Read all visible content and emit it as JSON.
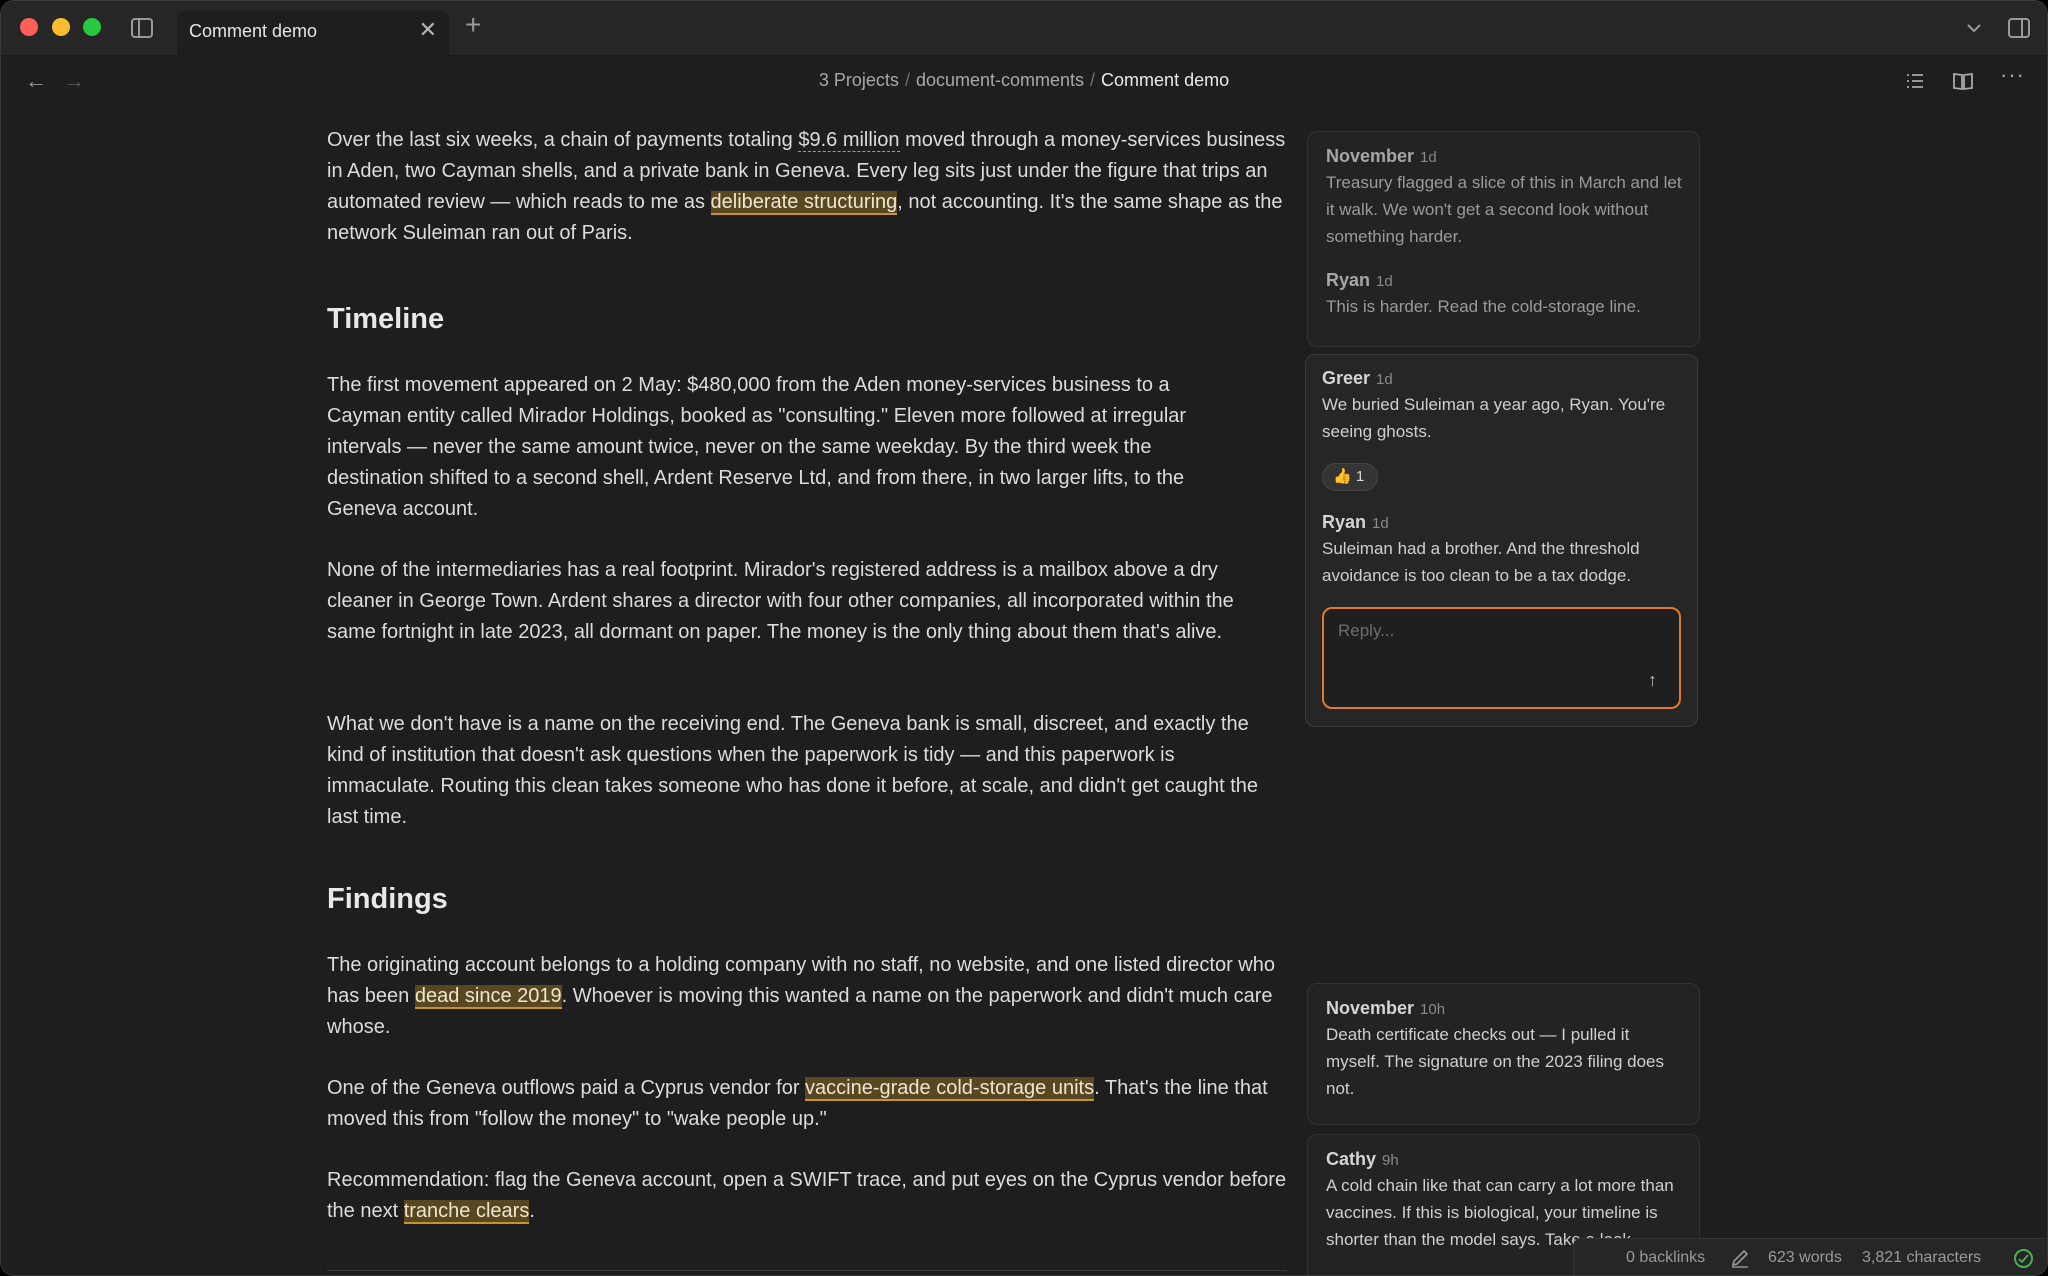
{
  "window": {
    "tab_title": "Comment demo",
    "tab_close": "✕",
    "new_tab": "+"
  },
  "nav": {
    "back": "←",
    "forward": "→",
    "breadcrumb": [
      "3 Projects",
      "document-comments",
      "Comment demo"
    ],
    "separator": "/",
    "more": "···"
  },
  "document": {
    "intro": {
      "before_money": "Over the last six weeks, a chain of payments totaling ",
      "money": "$9.6 million",
      "after_money": " moved through a money-services business in Aden, two Cayman shells, and a private bank in Geneva. Every leg sits just under the figure that trips an automated review — which reads to me as ",
      "highlight": "deliberate structuring",
      "after_highlight": ", not accounting. It's the same shape as the network Suleiman ran out of Paris."
    },
    "heading_timeline": "Timeline",
    "timeline_p1": "The first movement appeared on 2 May: $480,000 from the Aden money-services business to a Cayman entity called Mirador Holdings, booked as \"consulting.\" Eleven more followed at irregular intervals — never the same amount twice, never on the same weekday. By the third week the destination shifted to a second shell, Ardent Reserve Ltd, and from there, in two larger lifts, to the Geneva account.",
    "timeline_p2": "None of the intermediaries has a real footprint. Mirador's registered address is a mailbox above a dry cleaner in George Town. Ardent shares a director with four other companies, all incorporated within the same fortnight in late 2023, all dormant on paper. The money is the only thing about them that's alive.",
    "timeline_p3": "What we don't have is a name on the receiving end. The Geneva bank is small, discreet, and exactly the kind of institution that doesn't ask questions when the paperwork is tidy — and this paperwork is immaculate. Routing this clean takes someone who has done it before, at scale, and didn't get caught the last time.",
    "heading_findings": "Findings",
    "findings_p1": {
      "before": "The originating account belongs to a holding company with no staff, no website, and one listed director who has been ",
      "highlight": "dead since 2019",
      "after": ". Whoever is moving this wanted a name on the paperwork and didn't much care whose."
    },
    "findings_p2": {
      "before": "One of the Geneva outflows paid a Cyprus vendor for ",
      "highlight": "vaccine-grade cold-storage units",
      "after": ". That's the line that moved this from \"follow the money\" to \"wake people up.\""
    },
    "findings_p3": {
      "before": "Recommendation: flag the Geneva account, open a SWIFT trace, and put eyes on the Cyprus vendor before the next ",
      "highlight": "tranche clears",
      "after": "."
    }
  },
  "comments": {
    "thread1": [
      {
        "author": "November",
        "time": "1d",
        "text": "Treasury flagged a slice of this in March and let it walk. We won't get a second look without something harder."
      },
      {
        "author": "Ryan",
        "time": "1d",
        "text": "This is harder. Read the cold-storage line."
      }
    ],
    "thread2": [
      {
        "author": "Greer",
        "time": "1d",
        "text": "We buried Suleiman a year ago, Ryan. You're seeing ghosts.",
        "reaction": "👍 1"
      },
      {
        "author": "Ryan",
        "time": "1d",
        "text": "Suleiman had a brother. And the threshold avoidance is too clean to be a tax dodge."
      }
    ],
    "reply_placeholder": "Reply...",
    "reply_send": "↑",
    "thread3": [
      {
        "author": "November",
        "time": "10h",
        "text": "Death certificate checks out — I pulled it myself. The signature on the 2023 filing does not."
      }
    ],
    "thread4": [
      {
        "author": "Cathy",
        "time": "9h",
        "text": "A cold chain like that can carry a lot more than vaccines. If this is biological, your timeline is shorter than the model says. Take a look."
      }
    ]
  },
  "status": {
    "backlinks": "0 backlinks",
    "words": "623 words",
    "characters": "3,821 characters"
  },
  "colors": {
    "accent": "#e07a2a",
    "highlight": "#c9932c",
    "background": "#1e1e1e"
  }
}
